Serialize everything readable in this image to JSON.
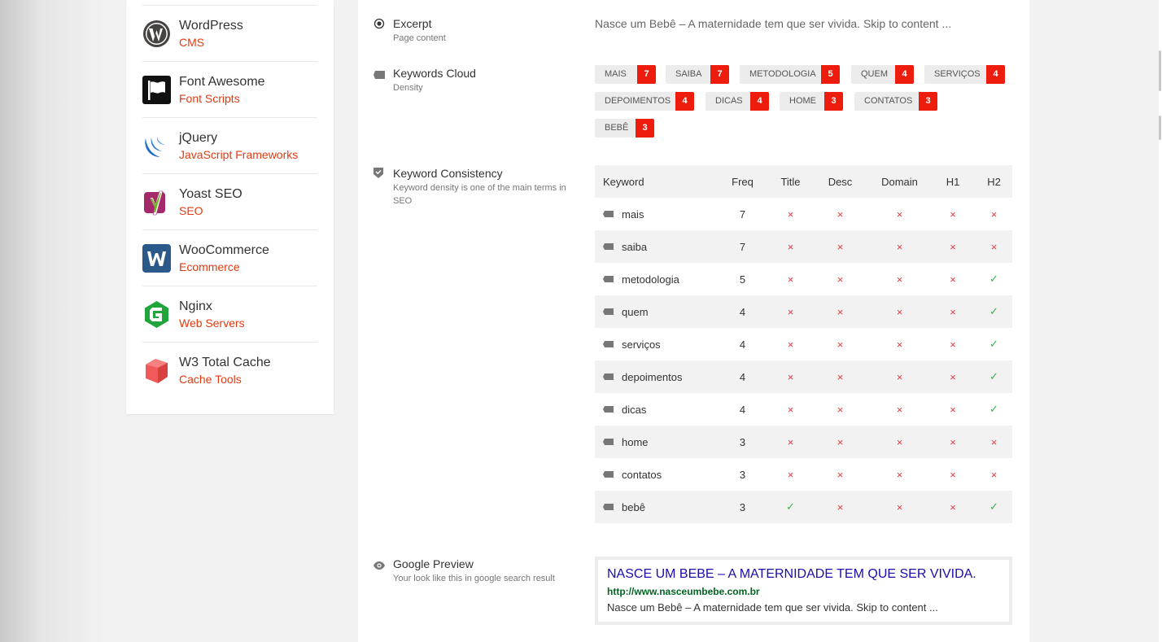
{
  "technologies": [
    {
      "name": "WordPress",
      "category": "CMS",
      "icon": "wordpress-icon"
    },
    {
      "name": "Font Awesome",
      "category": "Font Scripts",
      "icon": "font-awesome-icon"
    },
    {
      "name": "jQuery",
      "category": "JavaScript Frameworks",
      "icon": "jquery-icon"
    },
    {
      "name": "Yoast SEO",
      "category": "SEO",
      "icon": "yoast-icon"
    },
    {
      "name": "WooCommerce",
      "category": "Ecommerce",
      "icon": "woocommerce-icon"
    },
    {
      "name": "Nginx",
      "category": "Web Servers",
      "icon": "nginx-icon"
    },
    {
      "name": "W3 Total Cache",
      "category": "Cache Tools",
      "icon": "w3-total-cache-icon"
    }
  ],
  "excerpt": {
    "title": "Excerpt",
    "subtitle": "Page content",
    "text": "Nasce um Bebê – A maternidade tem que ser vivida. Skip to content ..."
  },
  "keywords_cloud": {
    "title": "Keywords Cloud",
    "subtitle": "Density",
    "tags": [
      {
        "label": "MAIS",
        "count": "7"
      },
      {
        "label": "SAIBA",
        "count": "7"
      },
      {
        "label": "METODOLOGIA",
        "count": "5"
      },
      {
        "label": "QUEM",
        "count": "4"
      },
      {
        "label": "SERVIÇOS",
        "count": "4"
      },
      {
        "label": "DEPOIMENTOS",
        "count": "4"
      },
      {
        "label": "DICAS",
        "count": "4"
      },
      {
        "label": "HOME",
        "count": "3"
      },
      {
        "label": "CONTATOS",
        "count": "3"
      },
      {
        "label": "BEBÊ",
        "count": "3"
      }
    ]
  },
  "keyword_consistency": {
    "title": "Keyword Consistency",
    "subtitle": "Keyword density is one of the main terms in SEO",
    "headers": [
      "Keyword",
      "Freq",
      "Title",
      "Desc",
      "Domain",
      "H1",
      "H2"
    ],
    "rows": [
      {
        "keyword": "mais",
        "freq": "7",
        "title": false,
        "desc": false,
        "domain": false,
        "h1": false,
        "h2": false
      },
      {
        "keyword": "saiba",
        "freq": "7",
        "title": false,
        "desc": false,
        "domain": false,
        "h1": false,
        "h2": false
      },
      {
        "keyword": "metodologia",
        "freq": "5",
        "title": false,
        "desc": false,
        "domain": false,
        "h1": false,
        "h2": true
      },
      {
        "keyword": "quem",
        "freq": "4",
        "title": false,
        "desc": false,
        "domain": false,
        "h1": false,
        "h2": true
      },
      {
        "keyword": "serviços",
        "freq": "4",
        "title": false,
        "desc": false,
        "domain": false,
        "h1": false,
        "h2": true
      },
      {
        "keyword": "depoimentos",
        "freq": "4",
        "title": false,
        "desc": false,
        "domain": false,
        "h1": false,
        "h2": true
      },
      {
        "keyword": "dicas",
        "freq": "4",
        "title": false,
        "desc": false,
        "domain": false,
        "h1": false,
        "h2": true
      },
      {
        "keyword": "home",
        "freq": "3",
        "title": false,
        "desc": false,
        "domain": false,
        "h1": false,
        "h2": false
      },
      {
        "keyword": "contatos",
        "freq": "3",
        "title": false,
        "desc": false,
        "domain": false,
        "h1": false,
        "h2": false
      },
      {
        "keyword": "bebê",
        "freq": "3",
        "title": true,
        "desc": false,
        "domain": false,
        "h1": false,
        "h2": true
      }
    ],
    "mark_yes": "✓",
    "mark_no": "×"
  },
  "google_preview": {
    "title": "Google Preview",
    "subtitle": "Your look like this in google search result",
    "result_title": "NASCE UM BEBE – A MATERNIDADE TEM QUE SER VIVIDA.",
    "result_url": "http://www.nasceumbebe.com.br",
    "result_desc": "Nasce um Bebê – A maternidade tem que ser vivida. Skip to content ..."
  },
  "colors": {
    "accent": "#e53a10",
    "count_badge": "#ee1c0c",
    "link_title": "#1a0dab",
    "link_url": "#006621",
    "check": "#3fae50",
    "cross": "#e53a3a"
  }
}
